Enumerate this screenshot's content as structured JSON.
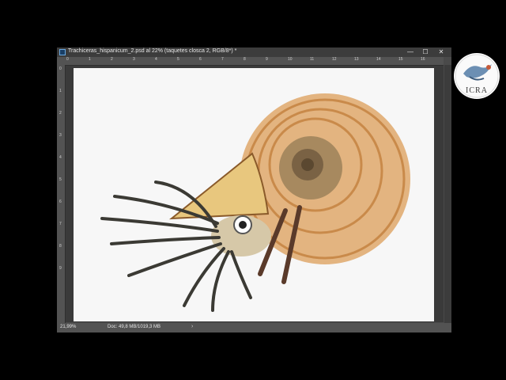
{
  "window": {
    "title": "Trachiceras_hispanicum_2.psd al 22% (taquetes closca 2, RGB/8*) *",
    "minimize_glyph": "—",
    "maximize_glyph": "☐",
    "close_glyph": "✕"
  },
  "rulers": {
    "horizontal": [
      "0",
      "1",
      "2",
      "3",
      "4",
      "5",
      "6",
      "7",
      "8",
      "9",
      "10",
      "11",
      "12",
      "13",
      "14",
      "15",
      "16"
    ],
    "vertical": [
      "0",
      "1",
      "2",
      "3",
      "4",
      "5",
      "6",
      "7",
      "8",
      "9"
    ]
  },
  "status": {
    "zoom": "21,99%",
    "doc": "Doc: 49,8 MB/1019,3 MB",
    "arrow": "›"
  },
  "logo": {
    "text": "ICRA"
  },
  "icons": {
    "app": "photoshop-icon",
    "logo_bird": "bird-icon",
    "artwork": "ammonite-illustration"
  },
  "colors": {
    "background": "#000000",
    "canvas": "#f7f7f7",
    "panel": "#535353",
    "shell": "#e3b480",
    "shell_ridge": "#c98a4a",
    "stripe": "#5a3a2a"
  }
}
